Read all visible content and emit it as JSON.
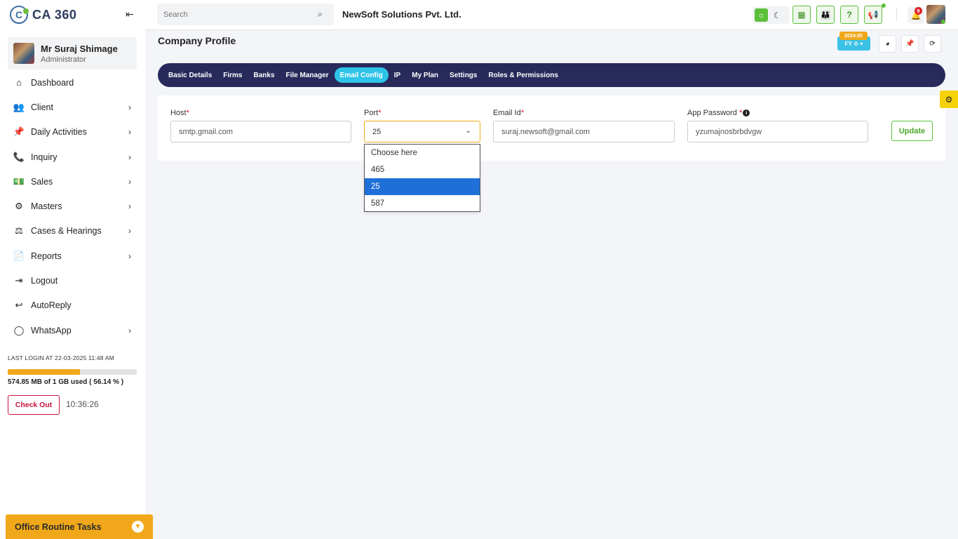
{
  "app": {
    "logo_text": "CA 360",
    "logo_letter": "C"
  },
  "user": {
    "name": "Mr Suraj Shimage",
    "role": "Administrator"
  },
  "sidebar": {
    "collapse_icon": "collapse-left-icon",
    "items": [
      {
        "label": "Dashboard",
        "icon": "home-icon",
        "glyph": "⌂",
        "chevron": false
      },
      {
        "label": "Client",
        "icon": "users-icon",
        "glyph": "👥",
        "chevron": true
      },
      {
        "label": "Daily Activities",
        "icon": "pin-icon",
        "glyph": "📌",
        "chevron": true
      },
      {
        "label": "Inquiry",
        "icon": "phone-icon",
        "glyph": "📞",
        "chevron": true
      },
      {
        "label": "Sales",
        "icon": "money-icon",
        "glyph": "💵",
        "chevron": true
      },
      {
        "label": "Masters",
        "icon": "gears-icon",
        "glyph": "⚙",
        "chevron": true
      },
      {
        "label": "Cases & Hearings",
        "icon": "scale-icon",
        "glyph": "⚖",
        "chevron": true
      },
      {
        "label": "Reports",
        "icon": "file-icon",
        "glyph": "📄",
        "chevron": true
      },
      {
        "label": "Logout",
        "icon": "logout-icon",
        "glyph": "⇥",
        "chevron": false
      },
      {
        "label": "AutoReply",
        "icon": "reply-all-icon",
        "glyph": "↩",
        "chevron": false
      },
      {
        "label": "WhatsApp",
        "icon": "whatsapp-icon",
        "glyph": "◯",
        "chevron": true
      }
    ],
    "last_login": "LAST LOGIN AT 22-03-2025 11:48 AM",
    "storage_percent": 56.14,
    "storage_text": "574.85 MB of 1 GB used ( 56.14 % )",
    "checkout_label": "Check Out",
    "clock": "10:36:26",
    "routine_label": "Office Routine Tasks"
  },
  "topbar": {
    "search_placeholder": "Search",
    "company": "NewSoft Solutions Pvt. Ltd.",
    "notification_count": "9"
  },
  "page": {
    "title": "Company Profile",
    "fy_year": "2024-25",
    "fy_label": "FY ⚙ ▾",
    "tabs": [
      {
        "label": "Basic Details",
        "active": false
      },
      {
        "label": "Firms",
        "active": false
      },
      {
        "label": "Banks",
        "active": false
      },
      {
        "label": "File Manager",
        "active": false
      },
      {
        "label": "Email Config",
        "active": true
      },
      {
        "label": "IP",
        "active": false
      },
      {
        "label": "My Plan",
        "active": false
      },
      {
        "label": "Settings",
        "active": false
      },
      {
        "label": "Roles & Permissions",
        "active": false
      }
    ]
  },
  "form": {
    "host_label": "Host",
    "host_value": "smtp.gmail.com",
    "port_label": "Port",
    "port_value": "25",
    "port_options": [
      "Choose here",
      "465",
      "25",
      "587"
    ],
    "port_selected_index": 2,
    "email_label": "Email Id",
    "email_value": "suraj.newsoft@gmail.com",
    "password_label": "App Password",
    "password_value": "yzumajnosbrbdvgw",
    "required_mark": "*",
    "update_label": "Update"
  },
  "colors": {
    "tab_bar": "#282a5c",
    "active_tab": "#2ec4e8",
    "accent_green": "#5cbf3a",
    "accent_orange": "#f0a81a",
    "required_red": "#d8162a",
    "selected_option": "#1f6fd8"
  }
}
